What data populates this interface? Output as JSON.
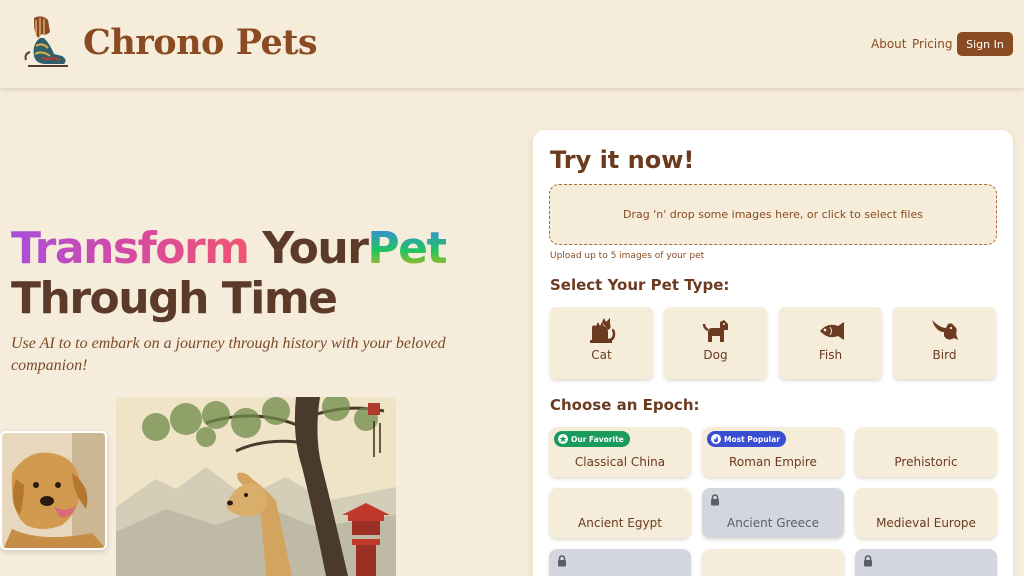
{
  "header": {
    "brand": "Chrono Pets",
    "nav": [
      {
        "label": "About"
      },
      {
        "label": "Pricing"
      }
    ],
    "signin_label": "Sign In"
  },
  "hero": {
    "headline_word1": "Transform",
    "headline_word2": "Your",
    "headline_word3": "Pet",
    "headline_line2": "Through Time",
    "subtitle": "Use AI to to embark on a journey through history with your beloved companion!"
  },
  "card": {
    "title": "Try it now!",
    "dropzone_text": "Drag 'n' drop some images here, or click to select files",
    "upload_hint": "Upload up to 5 images of your pet",
    "pet_heading": "Select Your Pet Type:",
    "pets": [
      {
        "label": "Cat",
        "icon": "cat-icon"
      },
      {
        "label": "Dog",
        "icon": "dog-icon"
      },
      {
        "label": "Fish",
        "icon": "fish-icon"
      },
      {
        "label": "Bird",
        "icon": "bird-icon"
      }
    ],
    "epoch_heading": "Choose an Epoch:",
    "epochs": [
      {
        "label": "Classical China",
        "badge": "Our Favorite",
        "locked": false
      },
      {
        "label": "Roman Empire",
        "badge": "Most Popular",
        "locked": false
      },
      {
        "label": "Prehistoric",
        "locked": false
      },
      {
        "label": "Ancient Egypt",
        "locked": false
      },
      {
        "label": "Ancient Greece",
        "locked": true
      },
      {
        "label": "Medieval Europe",
        "locked": false
      }
    ]
  },
  "colors": {
    "background": "#f5ecdc",
    "brand": "#8a4b22",
    "card": "#ffffff",
    "badge_green": "#1a9a5c",
    "badge_blue": "#3a4ed3",
    "locked": "#d3d6dd"
  }
}
